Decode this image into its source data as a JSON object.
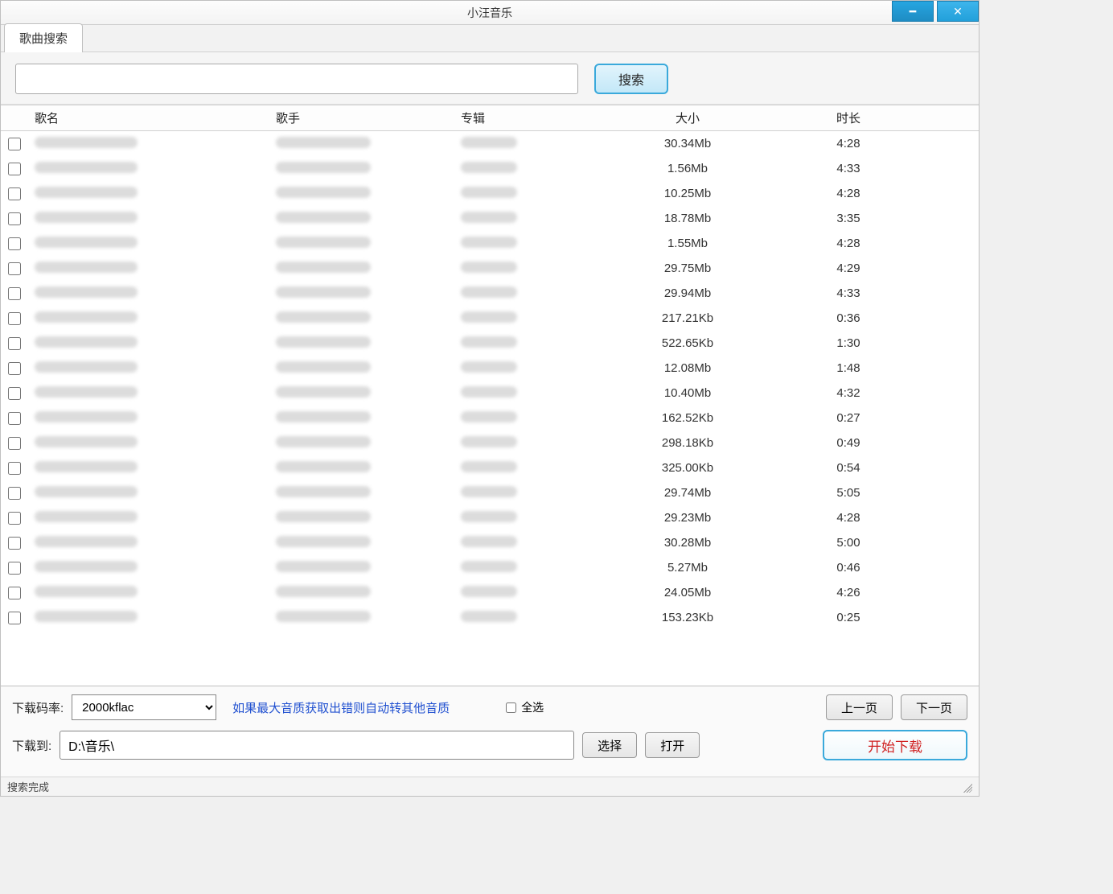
{
  "window": {
    "title": "小汪音乐"
  },
  "tab": {
    "label": "歌曲搜索"
  },
  "search": {
    "value": "",
    "button": "搜索"
  },
  "table": {
    "headers": {
      "name": "歌名",
      "artist": "歌手",
      "album": "专辑",
      "size": "大小",
      "duration": "时长"
    },
    "rows": [
      {
        "size": "30.34Mb",
        "duration": "4:28"
      },
      {
        "size": "1.56Mb",
        "duration": "4:33"
      },
      {
        "size": "10.25Mb",
        "duration": "4:28"
      },
      {
        "size": "18.78Mb",
        "duration": "3:35"
      },
      {
        "size": "1.55Mb",
        "duration": "4:28"
      },
      {
        "size": "29.75Mb",
        "duration": "4:29"
      },
      {
        "size": "29.94Mb",
        "duration": "4:33"
      },
      {
        "size": "217.21Kb",
        "duration": "0:36"
      },
      {
        "size": "522.65Kb",
        "duration": "1:30"
      },
      {
        "size": "12.08Mb",
        "duration": "1:48"
      },
      {
        "size": "10.40Mb",
        "duration": "4:32"
      },
      {
        "size": "162.52Kb",
        "duration": "0:27"
      },
      {
        "size": "298.18Kb",
        "duration": "0:49"
      },
      {
        "size": "325.00Kb",
        "duration": "0:54"
      },
      {
        "size": "29.74Mb",
        "duration": "5:05"
      },
      {
        "size": "29.23Mb",
        "duration": "4:28"
      },
      {
        "size": "30.28Mb",
        "duration": "5:00"
      },
      {
        "size": "5.27Mb",
        "duration": "0:46"
      },
      {
        "size": "24.05Mb",
        "duration": "4:26"
      },
      {
        "size": "153.23Kb",
        "duration": "0:25"
      }
    ]
  },
  "footer": {
    "bitrate_label": "下载码率:",
    "bitrate_value": "2000kflac",
    "hint": "如果最大音质获取出错则自动转其他音质",
    "select_all": "全选",
    "prev_page": "上一页",
    "next_page": "下一页",
    "download_to_label": "下载到:",
    "download_path": "D:\\音乐\\",
    "choose": "选择",
    "open": "打开",
    "start_download": "开始下载"
  },
  "status": "搜索完成"
}
